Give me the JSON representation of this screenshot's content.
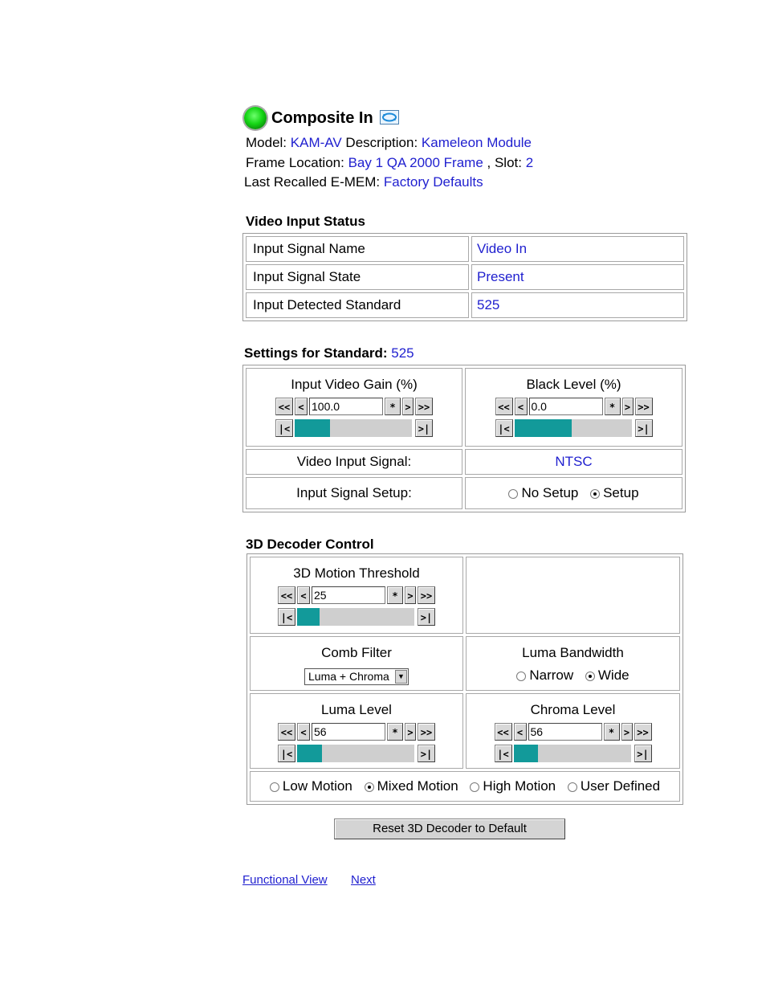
{
  "header": {
    "title": "Composite In",
    "model_label": "Model:",
    "model": "KAM-AV",
    "description_label": "Description:",
    "description": "Kameleon Module",
    "frame_location_label": "Frame Location:",
    "frame_location": "Bay 1 QA 2000 Frame",
    "slot_label": ", Slot:",
    "slot": "2",
    "last_emem_label": "Last Recalled E-MEM:",
    "last_emem": "Factory Defaults",
    "icons": {
      "status": "green-status-led-icon",
      "refresh": "refresh-icon"
    }
  },
  "video_input_status": {
    "title": "Video Input Status",
    "rows": [
      {
        "label": "Input Signal Name",
        "value": "Video In"
      },
      {
        "label": "Input Signal State",
        "value": "Present"
      },
      {
        "label": "Input Detected Standard",
        "value": "525"
      }
    ]
  },
  "settings": {
    "title": "Settings for Standard:",
    "standard": "525",
    "gain": {
      "label": "Input Video Gain (%)",
      "value": "100.0",
      "fill": 0.3
    },
    "black": {
      "label": "Black Level (%)",
      "value": "0.0",
      "fill": 0.49
    },
    "video_input_signal_label": "Video Input Signal:",
    "video_input_signal": "NTSC",
    "setup_label": "Input Signal Setup:",
    "setup_options": [
      {
        "label": "No Setup",
        "selected": false
      },
      {
        "label": "Setup",
        "selected": true
      }
    ]
  },
  "decoder": {
    "title": "3D Decoder Control",
    "motion": {
      "label": "3D Motion Threshold",
      "value": "25",
      "fill": 0.19
    },
    "comb": {
      "label": "Comb Filter",
      "selected": "Luma + Chroma"
    },
    "luma_bw": {
      "label": "Luma Bandwidth",
      "options": [
        {
          "label": "Narrow",
          "selected": false
        },
        {
          "label": "Wide",
          "selected": true
        }
      ]
    },
    "luma_level": {
      "label": "Luma Level",
      "value": "56",
      "fill": 0.21
    },
    "chroma_level": {
      "label": "Chroma Level",
      "value": "56",
      "fill": 0.21
    },
    "motion_modes": [
      {
        "label": "Low Motion",
        "selected": false
      },
      {
        "label": "Mixed Motion",
        "selected": true
      },
      {
        "label": "High Motion",
        "selected": false
      },
      {
        "label": "User Defined",
        "selected": false
      }
    ],
    "reset_label": "Reset 3D Decoder to Default"
  },
  "buttons": {
    "ff": "<<",
    "f": "<",
    "star": "*",
    "n": ">",
    "nn": ">>",
    "first": "|<",
    "last": ">|"
  },
  "footer": {
    "functional_view": "Functional View",
    "next": "Next"
  },
  "colors": {
    "link": "#1f1fcf",
    "bar_fill": "#129a9a",
    "bar_bg": "#cfcfcf",
    "led": "#16d616"
  }
}
